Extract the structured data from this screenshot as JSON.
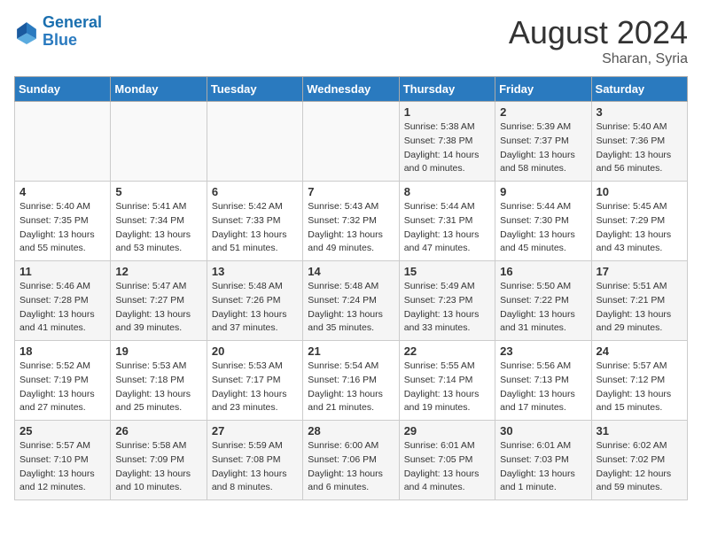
{
  "logo": {
    "text_general": "General",
    "text_blue": "Blue"
  },
  "title": "August 2024",
  "location": "Sharan, Syria",
  "days_of_week": [
    "Sunday",
    "Monday",
    "Tuesday",
    "Wednesday",
    "Thursday",
    "Friday",
    "Saturday"
  ],
  "weeks": [
    [
      {
        "day": "",
        "info": ""
      },
      {
        "day": "",
        "info": ""
      },
      {
        "day": "",
        "info": ""
      },
      {
        "day": "",
        "info": ""
      },
      {
        "day": "1",
        "info": "Sunrise: 5:38 AM\nSunset: 7:38 PM\nDaylight: 14 hours\nand 0 minutes."
      },
      {
        "day": "2",
        "info": "Sunrise: 5:39 AM\nSunset: 7:37 PM\nDaylight: 13 hours\nand 58 minutes."
      },
      {
        "day": "3",
        "info": "Sunrise: 5:40 AM\nSunset: 7:36 PM\nDaylight: 13 hours\nand 56 minutes."
      }
    ],
    [
      {
        "day": "4",
        "info": "Sunrise: 5:40 AM\nSunset: 7:35 PM\nDaylight: 13 hours\nand 55 minutes."
      },
      {
        "day": "5",
        "info": "Sunrise: 5:41 AM\nSunset: 7:34 PM\nDaylight: 13 hours\nand 53 minutes."
      },
      {
        "day": "6",
        "info": "Sunrise: 5:42 AM\nSunset: 7:33 PM\nDaylight: 13 hours\nand 51 minutes."
      },
      {
        "day": "7",
        "info": "Sunrise: 5:43 AM\nSunset: 7:32 PM\nDaylight: 13 hours\nand 49 minutes."
      },
      {
        "day": "8",
        "info": "Sunrise: 5:44 AM\nSunset: 7:31 PM\nDaylight: 13 hours\nand 47 minutes."
      },
      {
        "day": "9",
        "info": "Sunrise: 5:44 AM\nSunset: 7:30 PM\nDaylight: 13 hours\nand 45 minutes."
      },
      {
        "day": "10",
        "info": "Sunrise: 5:45 AM\nSunset: 7:29 PM\nDaylight: 13 hours\nand 43 minutes."
      }
    ],
    [
      {
        "day": "11",
        "info": "Sunrise: 5:46 AM\nSunset: 7:28 PM\nDaylight: 13 hours\nand 41 minutes."
      },
      {
        "day": "12",
        "info": "Sunrise: 5:47 AM\nSunset: 7:27 PM\nDaylight: 13 hours\nand 39 minutes."
      },
      {
        "day": "13",
        "info": "Sunrise: 5:48 AM\nSunset: 7:26 PM\nDaylight: 13 hours\nand 37 minutes."
      },
      {
        "day": "14",
        "info": "Sunrise: 5:48 AM\nSunset: 7:24 PM\nDaylight: 13 hours\nand 35 minutes."
      },
      {
        "day": "15",
        "info": "Sunrise: 5:49 AM\nSunset: 7:23 PM\nDaylight: 13 hours\nand 33 minutes."
      },
      {
        "day": "16",
        "info": "Sunrise: 5:50 AM\nSunset: 7:22 PM\nDaylight: 13 hours\nand 31 minutes."
      },
      {
        "day": "17",
        "info": "Sunrise: 5:51 AM\nSunset: 7:21 PM\nDaylight: 13 hours\nand 29 minutes."
      }
    ],
    [
      {
        "day": "18",
        "info": "Sunrise: 5:52 AM\nSunset: 7:19 PM\nDaylight: 13 hours\nand 27 minutes."
      },
      {
        "day": "19",
        "info": "Sunrise: 5:53 AM\nSunset: 7:18 PM\nDaylight: 13 hours\nand 25 minutes."
      },
      {
        "day": "20",
        "info": "Sunrise: 5:53 AM\nSunset: 7:17 PM\nDaylight: 13 hours\nand 23 minutes."
      },
      {
        "day": "21",
        "info": "Sunrise: 5:54 AM\nSunset: 7:16 PM\nDaylight: 13 hours\nand 21 minutes."
      },
      {
        "day": "22",
        "info": "Sunrise: 5:55 AM\nSunset: 7:14 PM\nDaylight: 13 hours\nand 19 minutes."
      },
      {
        "day": "23",
        "info": "Sunrise: 5:56 AM\nSunset: 7:13 PM\nDaylight: 13 hours\nand 17 minutes."
      },
      {
        "day": "24",
        "info": "Sunrise: 5:57 AM\nSunset: 7:12 PM\nDaylight: 13 hours\nand 15 minutes."
      }
    ],
    [
      {
        "day": "25",
        "info": "Sunrise: 5:57 AM\nSunset: 7:10 PM\nDaylight: 13 hours\nand 12 minutes."
      },
      {
        "day": "26",
        "info": "Sunrise: 5:58 AM\nSunset: 7:09 PM\nDaylight: 13 hours\nand 10 minutes."
      },
      {
        "day": "27",
        "info": "Sunrise: 5:59 AM\nSunset: 7:08 PM\nDaylight: 13 hours\nand 8 minutes."
      },
      {
        "day": "28",
        "info": "Sunrise: 6:00 AM\nSunset: 7:06 PM\nDaylight: 13 hours\nand 6 minutes."
      },
      {
        "day": "29",
        "info": "Sunrise: 6:01 AM\nSunset: 7:05 PM\nDaylight: 13 hours\nand 4 minutes."
      },
      {
        "day": "30",
        "info": "Sunrise: 6:01 AM\nSunset: 7:03 PM\nDaylight: 13 hours\nand 1 minute."
      },
      {
        "day": "31",
        "info": "Sunrise: 6:02 AM\nSunset: 7:02 PM\nDaylight: 12 hours\nand 59 minutes."
      }
    ]
  ]
}
